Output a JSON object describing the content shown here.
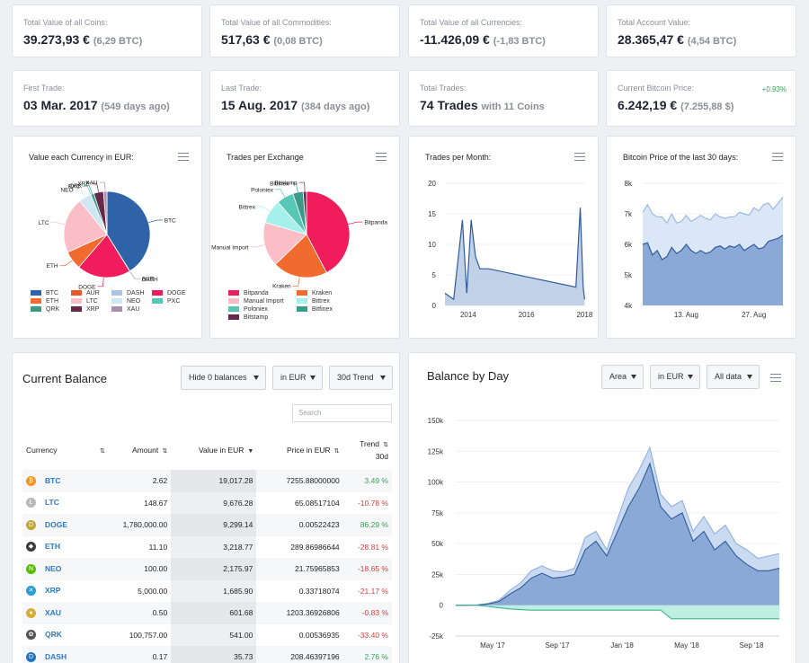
{
  "stats_row1": [
    {
      "label": "Total Value of all Coins:",
      "value": "39.273,93 €",
      "sub": "(6,29 BTC)"
    },
    {
      "label": "Total Value of all Commodities:",
      "value": "517,63 €",
      "sub": "(0,08 BTC)"
    },
    {
      "label": "Total Value of all Currencies:",
      "value": "-11.426,09 €",
      "sub": "(-1,83 BTC)"
    },
    {
      "label": "Total Account Value:",
      "value": "28.365,47 €",
      "sub": "(4,54 BTC)"
    }
  ],
  "stats_row2": [
    {
      "label": "First Trade:",
      "value": "03 Mar. 2017",
      "sub": "(549 days ago)"
    },
    {
      "label": "Last Trade:",
      "value": "15 Aug. 2017",
      "sub": "(384 days ago)"
    },
    {
      "label": "Total Trades:",
      "value": "74 Trades",
      "sub": "with 11 Coins"
    },
    {
      "label": "Current Bitcoin Price:",
      "value": "6.242,19 €",
      "sub": "(7.255,88 $)",
      "change": "+0.93%"
    }
  ],
  "charts": {
    "currency_title": "Value each Currency in EUR:",
    "exchange_title": "Trades per Exchange",
    "month_title": "Trades per Month:",
    "btc_title": "Bitcoin Price of the last 30 days:",
    "balance_title": "Balance by Day"
  },
  "chart_data": [
    {
      "type": "pie",
      "title": "Value each Currency in EUR:",
      "categories": [
        "BTC",
        "AUR",
        "DASH",
        "DOGE",
        "ETH",
        "LTC",
        "NEO",
        "PXC",
        "QRK",
        "XRP",
        "XAU"
      ],
      "values": [
        19017.28,
        1.0,
        35.73,
        9299.14,
        3218.77,
        9676.28,
        2175.97,
        1.0,
        541.0,
        1685.9,
        601.68
      ],
      "colors": [
        "#2f63a8",
        "#f0552a",
        "#a9c4e8",
        "#f01c5c",
        "#f06b2d",
        "#fbbdc6",
        "#cde8f3",
        "#57c7b6",
        "#3c9a88",
        "#66294a",
        "#a98fb0"
      ],
      "legend": [
        "BTC",
        "AUR",
        "DASH",
        "DOGE",
        "ETH",
        "LTC",
        "NEO",
        "PXC",
        "QRK",
        "XRP",
        "XAU"
      ]
    },
    {
      "type": "pie",
      "title": "Trades per Exchange",
      "categories": [
        "Bitpanda",
        "Kraken",
        "Manual Import",
        "Bittrex",
        "Poloniex",
        "Bitfinex",
        "Bitstamp"
      ],
      "values": [
        33,
        16,
        13,
        7,
        5,
        3,
        1
      ],
      "colors": [
        "#f01c5c",
        "#f06b2d",
        "#fbbdc6",
        "#a5f0ea",
        "#57c7b6",
        "#3c9a88",
        "#66294a"
      ],
      "legend": [
        "Bitpanda",
        "Kraken",
        "Manual Import",
        "Bittrex",
        "Poloniex",
        "Bitfinex",
        "Bitstamp"
      ]
    },
    {
      "type": "area",
      "title": "Trades per Month:",
      "x": [
        2013.2,
        2013.5,
        2013.8,
        2013.95,
        2014.1,
        2014.25,
        2014.4,
        2014.55,
        2014.7,
        2017.7,
        2017.85,
        2017.95,
        2018.0
      ],
      "values": [
        2,
        1,
        14,
        2,
        14,
        8,
        6,
        6,
        6,
        3,
        16,
        3,
        1
      ],
      "ylim": [
        0,
        20
      ],
      "x_ticks": [
        "2014",
        "2016",
        "2018"
      ],
      "y_ticks": [
        0,
        5,
        10,
        15,
        20
      ]
    },
    {
      "type": "area",
      "title": "Bitcoin Price of the last 30 days:",
      "x_ticks": [
        "13. Aug",
        "27. Aug"
      ],
      "y_ticks": [
        "4k",
        "5k",
        "6k",
        "7k",
        "8k"
      ],
      "ylim": [
        4000,
        8000
      ],
      "series": [
        {
          "values": [
            7050,
            7300,
            7000,
            6900,
            6900,
            6700,
            7000,
            6700,
            6750,
            6950,
            6750,
            6850,
            6950,
            6850,
            6800,
            7000,
            6900,
            6850,
            6900,
            6900,
            7050,
            7000,
            6950,
            7200,
            7100,
            7300,
            7350,
            7150,
            7350,
            7550
          ]
        },
        {
          "values": [
            6000,
            6050,
            5650,
            5800,
            5500,
            5600,
            5900,
            5700,
            5800,
            6000,
            5800,
            5700,
            5800,
            5700,
            5750,
            5900,
            5950,
            5850,
            5950,
            5900,
            6000,
            5800,
            5900,
            6000,
            5850,
            5900,
            6100,
            6150,
            6200,
            6300
          ]
        }
      ]
    },
    {
      "type": "area",
      "title": "Balance by Day",
      "x_ticks": [
        "May '17",
        "Sep '17",
        "Jan '18",
        "May '18",
        "Sep '18"
      ],
      "y_ticks": [
        "-25k",
        "0",
        "25k",
        "50k",
        "75k",
        "100k",
        "125k",
        "150k"
      ],
      "ylim": [
        -25000,
        150000
      ],
      "series": [
        {
          "values": [
            0,
            0,
            200,
            1500,
            4000,
            12000,
            18000,
            28000,
            32000,
            28000,
            27000,
            30000,
            55000,
            60000,
            45000,
            70000,
            95000,
            110000,
            128000,
            90000,
            80000,
            85000,
            60000,
            72000,
            58000,
            65000,
            50000,
            45000,
            38000,
            40000,
            42000
          ]
        },
        {
          "values": [
            0,
            0,
            200,
            1000,
            3000,
            9000,
            14000,
            22000,
            26000,
            22000,
            23000,
            25000,
            45000,
            52000,
            40000,
            60000,
            80000,
            95000,
            115000,
            80000,
            70000,
            75000,
            52000,
            60000,
            45000,
            52000,
            40000,
            33000,
            28000,
            28000,
            30000
          ]
        },
        {
          "values": [
            0,
            0,
            0,
            -1000,
            -2000,
            -3000,
            -3500,
            -4000,
            -4000,
            -4000,
            -4000,
            -4000,
            -4000,
            -4000,
            -4000,
            -4000,
            -4000,
            -4000,
            -4000,
            -4000,
            -11000,
            -11000,
            -11000,
            -11000,
            -11000,
            -11000,
            -11000,
            -11000,
            -11000,
            -11000,
            -11000
          ]
        }
      ]
    }
  ],
  "balance": {
    "title": "Current Balance",
    "dd_hide": "Hide 0 balances",
    "dd_currency": "in EUR",
    "dd_trend": "30d Trend",
    "search_placeholder": "Search",
    "columns": {
      "currency": "Currency",
      "amount": "Amount",
      "value": "Value in EUR",
      "price": "Price in EUR",
      "trend_1": "Trend",
      "trend_2": "30d"
    },
    "rows": [
      {
        "sym": "BTC",
        "amount": "2.62",
        "value": "19,017.28",
        "price": "7255.88000000",
        "trend": "3.49 %",
        "pos": true,
        "color": "#f7931a",
        "glyph": "₿"
      },
      {
        "sym": "LTC",
        "amount": "148.67",
        "value": "9,676.28",
        "price": "65.08517104",
        "trend": "-10.78 %",
        "pos": false,
        "color": "#b8b8b8",
        "glyph": "Ł"
      },
      {
        "sym": "DOGE",
        "amount": "1,780,000.00",
        "value": "9,299.14",
        "price": "0.00522423",
        "trend": "86.29 %",
        "pos": true,
        "color": "#c2a633",
        "glyph": "D"
      },
      {
        "sym": "ETH",
        "amount": "11.10",
        "value": "3,218.77",
        "price": "289.86986644",
        "trend": "-28.81 %",
        "pos": false,
        "color": "#3c3c3d",
        "glyph": "◆"
      },
      {
        "sym": "NEO",
        "amount": "100.00",
        "value": "2,175.97",
        "price": "21.75965853",
        "trend": "-18.65 %",
        "pos": false,
        "color": "#58bf00",
        "glyph": "N"
      },
      {
        "sym": "XRP",
        "amount": "5,000.00",
        "value": "1,685.90",
        "price": "0.33718074",
        "trend": "-21.17 %",
        "pos": false,
        "color": "#2a9bd5",
        "glyph": "✕"
      },
      {
        "sym": "XAU",
        "amount": "0.50",
        "value": "601.68",
        "price": "1203.36926806",
        "trend": "-0.83 %",
        "pos": false,
        "color": "#d4af37",
        "glyph": "●"
      },
      {
        "sym": "QRK",
        "amount": "100,757.00",
        "value": "541.00",
        "price": "0.00536935",
        "trend": "-33.40 %",
        "pos": false,
        "color": "#555555",
        "glyph": "✿"
      },
      {
        "sym": "DASH",
        "amount": "0.17",
        "value": "35.73",
        "price": "208.46397196",
        "trend": "2.76 %",
        "pos": true,
        "color": "#1c75bc",
        "glyph": "D"
      }
    ]
  },
  "balance_by_day": {
    "dd_type": "Area",
    "dd_currency": "in EUR",
    "dd_range": "All data"
  },
  "colors": {
    "accent": "#2a7ac6",
    "positive": "#3aa35b",
    "negative": "#e03c3c",
    "area_dark": "#3d6fb3",
    "area_light": "#a9c4e8",
    "area_green": "#9fe0cc"
  }
}
